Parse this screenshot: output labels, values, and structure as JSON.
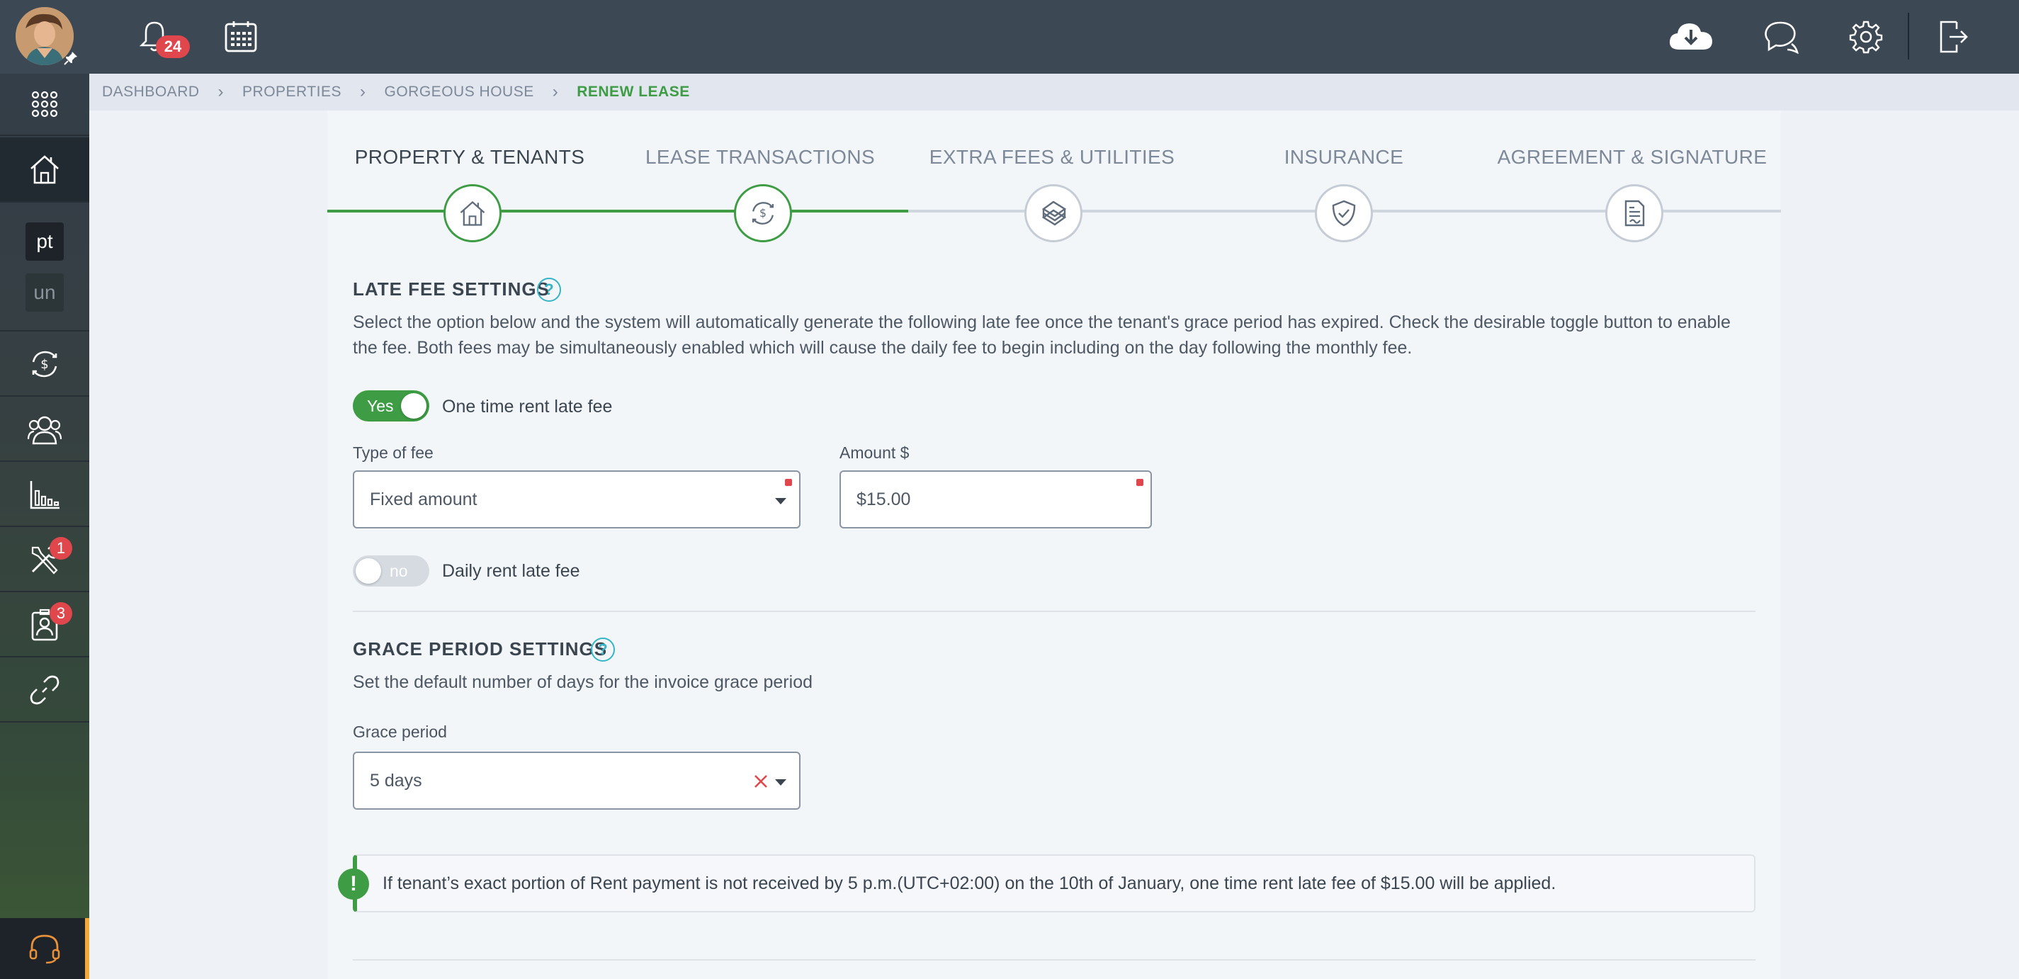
{
  "header": {
    "notifications_count": "24"
  },
  "sidebar": {
    "items": [
      {
        "name": "apps",
        "icon": "grid-icon"
      },
      {
        "name": "properties",
        "icon": "house-icon"
      },
      {
        "name": "pt",
        "label": "pt"
      },
      {
        "name": "un",
        "label": "un"
      },
      {
        "name": "transactions",
        "icon": "money-cycle-icon"
      },
      {
        "name": "people",
        "icon": "people-icon"
      },
      {
        "name": "reports",
        "icon": "bar-chart-icon"
      },
      {
        "name": "maintenance",
        "icon": "tools-icon",
        "badge": "1"
      },
      {
        "name": "applications",
        "icon": "badge-icon",
        "badge": "3"
      },
      {
        "name": "integrations",
        "icon": "link-icon"
      }
    ]
  },
  "breadcrumb": {
    "items": [
      "DASHBOARD",
      "PROPERTIES",
      "GORGEOUS HOUSE"
    ],
    "current": "RENEW LEASE"
  },
  "wizard": {
    "steps": [
      {
        "label": "PROPERTY & TENANTS",
        "state": "done",
        "icon": "house-icon"
      },
      {
        "label": "LEASE TRANSACTIONS",
        "state": "active",
        "icon": "money-cycle-icon"
      },
      {
        "label": "EXTRA FEES & UTILITIES",
        "state": "pending",
        "icon": "cash-stack-icon"
      },
      {
        "label": "INSURANCE",
        "state": "pending",
        "icon": "shield-icon"
      },
      {
        "label": "AGREEMENT & SIGNATURE",
        "state": "pending",
        "icon": "document-icon"
      }
    ]
  },
  "late_fee": {
    "title": "LATE FEE SETTINGS",
    "description": "Select the option below and the system will automatically generate the following late fee once the tenant's grace period has expired. Check the desirable toggle button to enable the fee. Both fees may be simultaneously enabled which will cause the daily fee to begin including on the day following the monthly fee.",
    "one_time_toggle": {
      "state_text": "Yes",
      "label": "One time rent late fee",
      "enabled": true
    },
    "type_of_fee": {
      "label": "Type of fee",
      "value": "Fixed amount"
    },
    "amount": {
      "label": "Amount $",
      "value": "$15.00"
    },
    "daily_toggle": {
      "state_text": "no",
      "label": "Daily rent late fee",
      "enabled": false
    }
  },
  "grace_period": {
    "title": "GRACE PERIOD SETTINGS",
    "description": "Set the default number of days for the invoice grace period",
    "field_label": "Grace period",
    "value": "5 days"
  },
  "notice": {
    "text": "If tenant’s exact portion of Rent payment is not received by 5 p.m.(UTC+02:00) on the 10th of January, one time rent late fee of $15.00 will be applied."
  },
  "colors": {
    "accent_green": "#3d9c44",
    "badge_red": "#e0474c",
    "help_cyan": "#35b4c6",
    "topbar": "#3c4853"
  }
}
